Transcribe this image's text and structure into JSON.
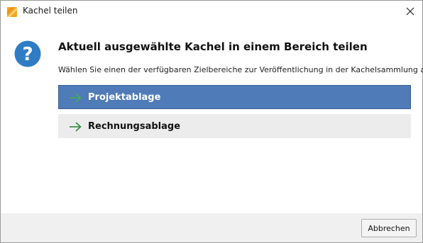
{
  "window": {
    "title": "Kachel teilen",
    "icon": "app-logo-icon",
    "close_icon": "close-icon"
  },
  "dialog": {
    "icon": "question-icon",
    "heading": "Aktuell ausgewählte Kachel in einem Bereich teilen",
    "description": "Wählen Sie einen der verfügbaren Zielbereiche zur Veröffentlichung in der Kachelsammlung aus.",
    "options": [
      {
        "label": "Projektablage",
        "icon": "arrow-right-icon",
        "selected": true
      },
      {
        "label": "Rechnungsablage",
        "icon": "arrow-right-icon",
        "selected": false
      }
    ]
  },
  "footer": {
    "cancel_label": "Abbrechen"
  },
  "colors": {
    "accent": "#4f7bb8",
    "arrow": "#2e8b3c",
    "question_icon": "#2f7cc5",
    "app_icon": "#f39c12",
    "option_background": "#ececec",
    "footer_background": "#f0f0f0"
  }
}
